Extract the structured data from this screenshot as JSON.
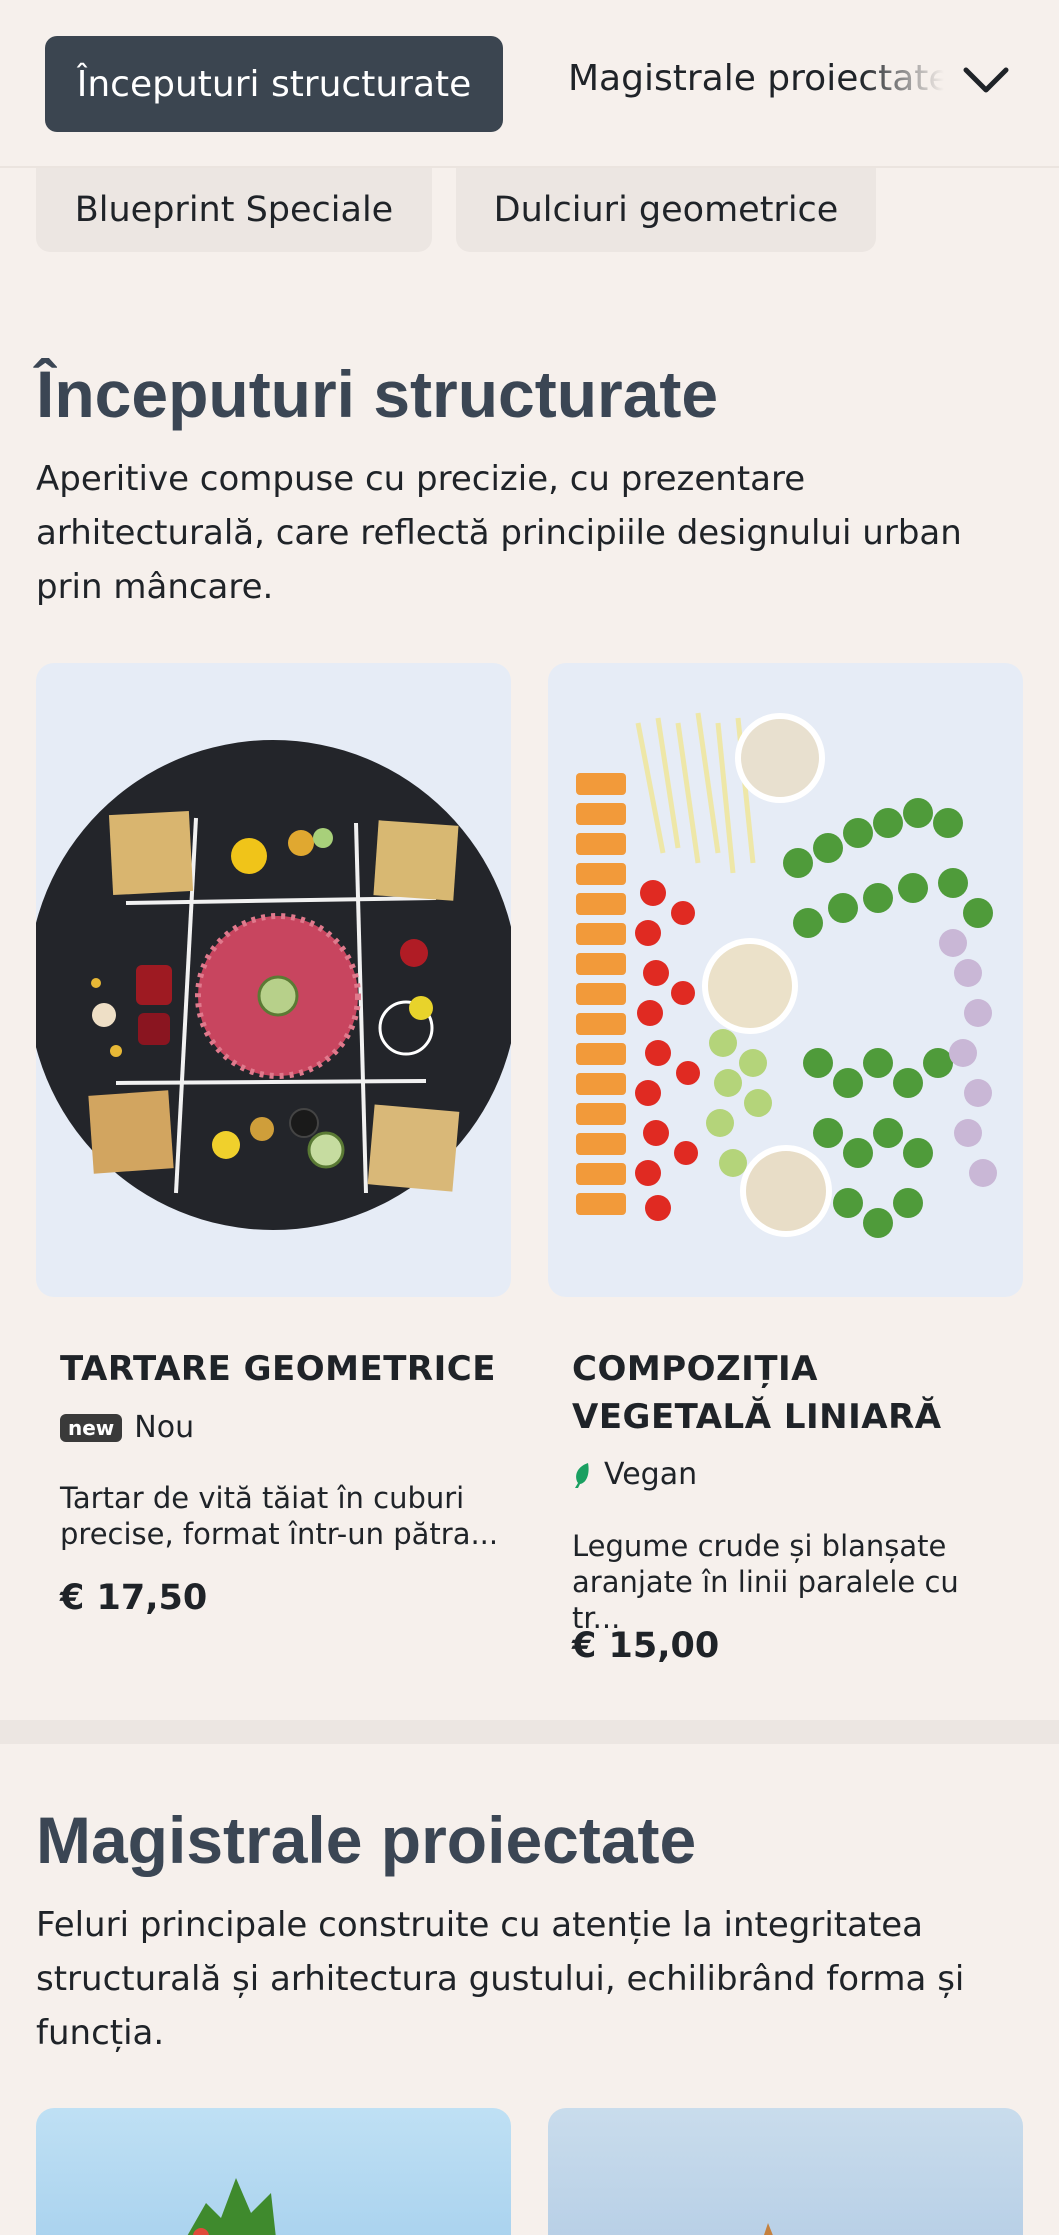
{
  "nav": {
    "active_tab": "Începuturi structurate",
    "next_tab": "Magistrale proiectate",
    "pills": [
      "Blueprint Speciale",
      "Dulciuri geometrice"
    ]
  },
  "section1": {
    "title": "Începuturi structurate",
    "description": "Aperitive compuse cu precizie, cu prezentare arhitecturală, care reflectă principiile designului urban prin mâncare.",
    "items": [
      {
        "title": "TARTARE GEOMETRICE",
        "badge_icon": "new",
        "badge_label": "Nou",
        "description_line1": "Tartar de vită tăiat în cuburi",
        "description_line2": "precise, format într-un pătra...",
        "price": "€ 17,50"
      },
      {
        "title_line1": "COMPOZIȚIA",
        "title_line2": "VEGETALĂ LINIARĂ",
        "badge_icon": "leaf-icon",
        "badge_label": "Vegan",
        "description_line1": "Legume crude și blanșate",
        "description_line2": "aranjate în linii paralele cu tr...",
        "price": "€ 15,00"
      }
    ]
  },
  "section2": {
    "title": "Magistrale proiectate",
    "description": "Feluri principale construite cu atenție la integritatea structurală și arhitectura gustului, echilibrând forma și funcția."
  },
  "colors": {
    "background": "#f6f0ec",
    "accent_dark": "#3b4550",
    "heading": "#3b4654",
    "vegan_green": "#1aa061"
  }
}
